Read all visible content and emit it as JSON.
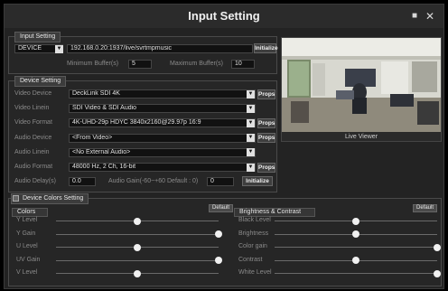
{
  "window": {
    "title": "Input Setting"
  },
  "input_setting": {
    "group_label": "Input Setting",
    "source_type": "DEVICE",
    "url": "192.168.0.20:1937/live/svrtmpmusic",
    "initialize_label": "Initialize",
    "min_buffer_label": "Minimum Buffer(s)",
    "min_buffer_value": "5",
    "max_buffer_label": "Maximum Buffer(s)",
    "max_buffer_value": "10"
  },
  "viewer": {
    "label": "Live Viewer"
  },
  "device_setting": {
    "group_label": "Device Setting",
    "rows": [
      {
        "label": "Video Device",
        "value": "DeckLink SDI 4K",
        "props": "Props"
      },
      {
        "label": "Video Linein",
        "value": "SDI Video & SDI Audio",
        "props": ""
      },
      {
        "label": "Video Format",
        "value": "4K-UHD-29p HDYC 3840x2160@29.97p 16:9",
        "props": "Props"
      },
      {
        "label": "Audio Device",
        "value": "<From Video>",
        "props": "Props"
      },
      {
        "label": "Audio Linein",
        "value": "<No External Audio>",
        "props": ""
      },
      {
        "label": "Audio Format",
        "value": "48000 Hz, 2 Ch, 16-bit",
        "props": "Props"
      }
    ],
    "audio_delay_label": "Audio Delay(s)",
    "audio_delay_value": "0.0",
    "audio_gain_label": "Audio Gain(-60~+60 Default : 0)",
    "audio_gain_value": "0",
    "initialize_label": "Initialize"
  },
  "colors_setting": {
    "group_label": "Device Colors Setting",
    "colors": {
      "title": "Colors",
      "default_label": "Default",
      "sliders": [
        {
          "label": "Y Level",
          "level": 0.5
        },
        {
          "label": "Y Gain",
          "level": 1.0
        },
        {
          "label": "U Level",
          "level": 0.5
        },
        {
          "label": "UV Gain",
          "level": 1.0
        },
        {
          "label": "V Level",
          "level": 0.5
        }
      ]
    },
    "brightness": {
      "title": "Brightness & Contrast",
      "default_label": "Default",
      "sliders": [
        {
          "label": "Black Level",
          "level": 0.5
        },
        {
          "label": "Brightness",
          "level": 0.5
        },
        {
          "label": "Color gain",
          "level": 1.0
        },
        {
          "label": "Contrast",
          "level": 0.5
        },
        {
          "label": "White Level",
          "level": 1.0
        }
      ]
    }
  }
}
